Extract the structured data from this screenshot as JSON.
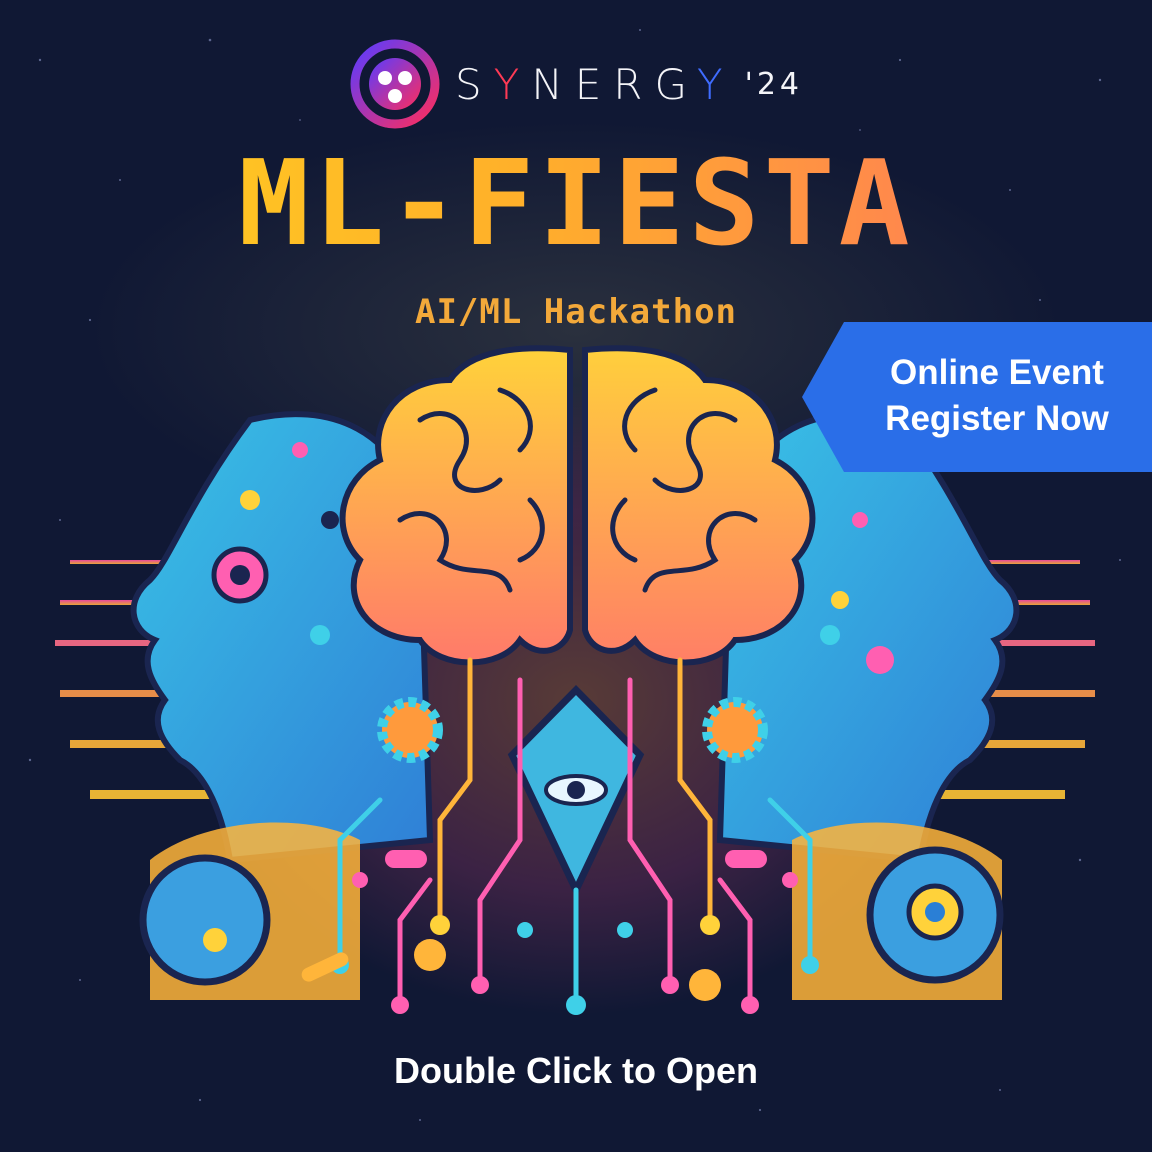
{
  "brand": {
    "name_part1": "S",
    "name_y1": "Y",
    "name_part2": "NERG",
    "name_y2": "Y",
    "year": "'24"
  },
  "event": {
    "title": "ML-FIESTA",
    "subtitle": "AI/ML Hackathon"
  },
  "ribbon": {
    "line1": "Online Event",
    "line2": "Register Now",
    "color": "#2a6ee8"
  },
  "cta": {
    "label": "Double Click to Open"
  },
  "colors": {
    "background": "#101834",
    "title_start": "#ffd21e",
    "title_end": "#ff6f62",
    "subtitle": "#f3a93a"
  }
}
